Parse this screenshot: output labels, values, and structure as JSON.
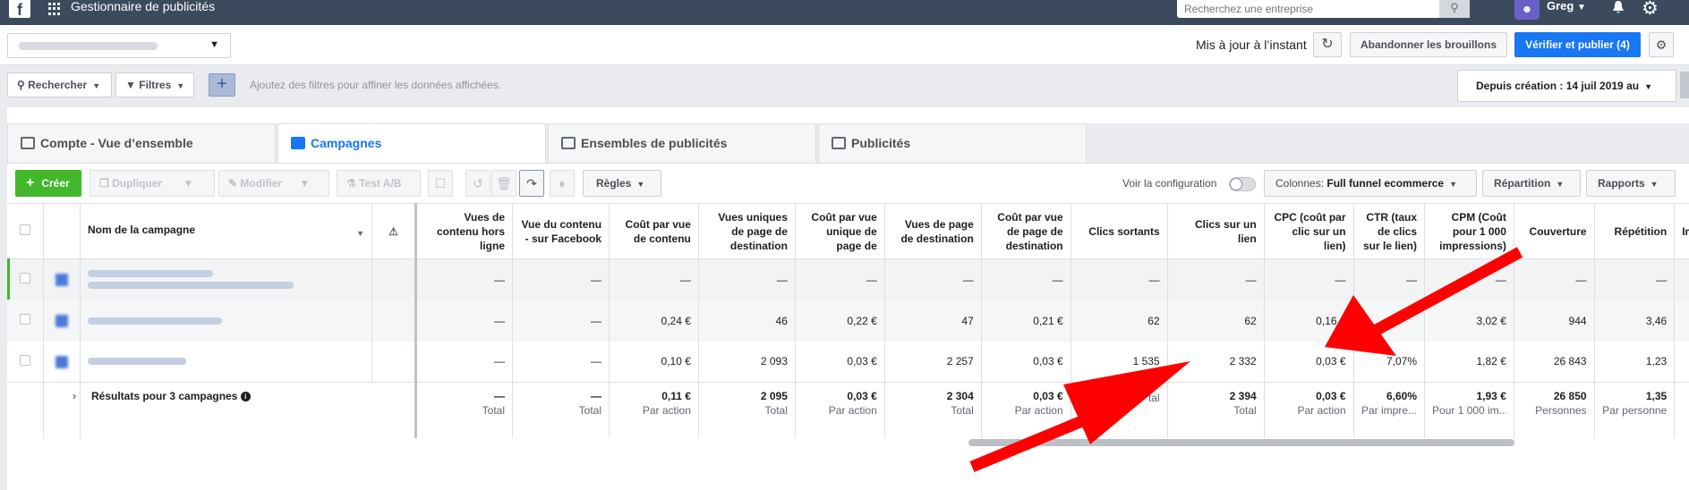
{
  "topbar": {
    "logo": "f",
    "app_title": "Gestionnaire de publicités",
    "search_placeholder": "Recherchez une entreprise",
    "user_name": "Greg"
  },
  "header": {
    "update_text": "Mis à jour à l’instant",
    "discard_label": "Abandonner les brouillons",
    "publish_label": "Vérifier et publier (4)"
  },
  "filters": {
    "search_label": "Rechercher",
    "filters_label": "Filtres",
    "hint": "Ajoutez des filtres pour affiner les données affichées.",
    "date_label": "Depuis création : 14 juil 2019 au"
  },
  "tabs": [
    {
      "label": "Compte - Vue d’ensemble",
      "icon": "account-overview-icon"
    },
    {
      "label": "Campagnes",
      "icon": "campaigns-icon"
    },
    {
      "label": "Ensembles de publicités",
      "icon": "ad-sets-icon"
    },
    {
      "label": "Publicités",
      "icon": "ads-icon"
    }
  ],
  "toolbar": {
    "create_label": "Créer",
    "duplicate_label": "Dupliquer",
    "modify_label": "Modifier",
    "ab_test_label": "Test A/B",
    "rules_label": "Règles",
    "config_label": "Voir la configuration",
    "columns_prefix": "Colonnes:",
    "columns_value": "Full funnel ecommerce",
    "breakdown_label": "Répartition",
    "reports_label": "Rapports"
  },
  "table": {
    "name_header": "Nom de la campagne",
    "headers": [
      "Vues de contenu hors ligne",
      "Vue du contenu - sur Facebook",
      "Coût par vue de contenu",
      "Vues uniques de page de destination",
      "Coût par vue unique de page de",
      "Vues de page de destination",
      "Coût par vue de page de destination",
      "Clics sortants",
      "Clics sur un lien",
      "CPC (coût par clic sur un lien)",
      "CTR (taux de clics sur le lien)",
      "CPM (Coût pour 1 000 impressions)",
      "Couverture",
      "Répétition",
      "Im"
    ],
    "rows": [
      [
        "—",
        "—",
        "—",
        "—",
        "—",
        "—",
        "—",
        "—",
        "—",
        "—",
        "—",
        "—",
        "—",
        "—",
        ""
      ],
      [
        "—",
        "—",
        "0,24 €",
        "46",
        "0,22 €",
        "47",
        "0,21 €",
        "62",
        "62",
        "0,16 €",
        "",
        "3,02 €",
        "944",
        "3,46",
        ""
      ],
      [
        "—",
        "—",
        "0,10 €",
        "2 093",
        "0,03 €",
        "2 257",
        "0,03 €",
        "1 535",
        "2 332",
        "0,03 €",
        "7,07%",
        "1,82 €",
        "26 843",
        "1,23",
        ""
      ]
    ],
    "totals_label": "Résultats pour 3 campagnes",
    "totals": [
      {
        "value": "—",
        "label": "Total"
      },
      {
        "value": "—",
        "label": "Total"
      },
      {
        "value": "0,11 €",
        "label": "Par action"
      },
      {
        "value": "2 095",
        "label": "Total"
      },
      {
        "value": "0,03 €",
        "label": "Par action"
      },
      {
        "value": "2 304",
        "label": "Total"
      },
      {
        "value": "0,03 €",
        "label": "Par action"
      },
      {
        "value": "",
        "label": "tal"
      },
      {
        "value": "2 394",
        "label": "Total"
      },
      {
        "value": "0,03 €",
        "label": "Par action"
      },
      {
        "value": "6,60%",
        "label": "Par impre..."
      },
      {
        "value": "1,93 €",
        "label": "Pour 1 000 im..."
      },
      {
        "value": "26 850",
        "label": "Personnes"
      },
      {
        "value": "1,35",
        "label": "Par personne"
      },
      {
        "value": "",
        "label": ""
      }
    ]
  },
  "colors": {
    "topbar": "#3b4a5c",
    "accent": "#1877f2",
    "create": "#42b72a",
    "arrow": "#ff0000"
  }
}
